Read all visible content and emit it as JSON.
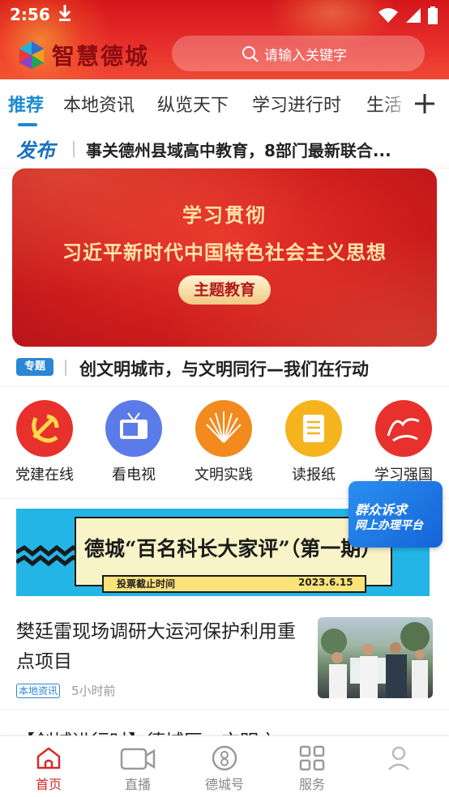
{
  "status_bar": {
    "time": "2:56"
  },
  "header": {
    "app_name": "智慧德城",
    "search_placeholder": "请输入关键字",
    "brand_color": "#e02a26"
  },
  "tabs": [
    {
      "label": "推荐",
      "active": true
    },
    {
      "label": "本地资讯",
      "active": false
    },
    {
      "label": "纵览天下",
      "active": false
    },
    {
      "label": "学习进行时",
      "active": false
    },
    {
      "label": "生活",
      "active": false
    }
  ],
  "ticker": {
    "badge": "发布",
    "text": "事关德州县域高中教育，8部门最新联合..."
  },
  "banner": {
    "line1": "学习贯彻",
    "line2": "习近平新时代中国特色社会主义思想",
    "pill": "主题教育"
  },
  "topic": {
    "badge": "专题",
    "text": "创文明城市，与文明同行—我们在行动"
  },
  "services": [
    {
      "label": "党建在线",
      "icon": "party-emblem-icon",
      "color": "#e8302c"
    },
    {
      "label": "看电视",
      "icon": "tv-icon",
      "color": "#5b7be8"
    },
    {
      "label": "文明实践",
      "icon": "civilization-fan-icon",
      "color": "#f28a1e"
    },
    {
      "label": "读报纸",
      "icon": "newspaper-icon",
      "color": "#f5b41d"
    },
    {
      "label": "学习强国",
      "icon": "xuexi-icon",
      "color": "#e8302c"
    }
  ],
  "floating": {
    "line1": "群众诉求",
    "line2": "网上办理平台"
  },
  "vote_banner": {
    "title": "德城“百名科长大家评”（第一期）",
    "deadline_label": "投票截止时间",
    "deadline_date": "2023.6.15"
  },
  "news": [
    {
      "title": "樊廷雷现场调研大运河保护利用重点项目",
      "tag": "本地资讯",
      "time": "5小时前"
    },
    {
      "title": "【创城进行时】德城区：文明之"
    }
  ],
  "bottom_nav": [
    {
      "label": "首页",
      "icon": "home-icon",
      "active": true
    },
    {
      "label": "直播",
      "icon": "video-camera-icon",
      "active": false
    },
    {
      "label": "德城号",
      "icon": "account-icon",
      "active": false
    },
    {
      "label": "服务",
      "icon": "grid-icon",
      "active": false
    },
    {
      "label": "",
      "icon": "profile-icon",
      "active": false
    }
  ]
}
